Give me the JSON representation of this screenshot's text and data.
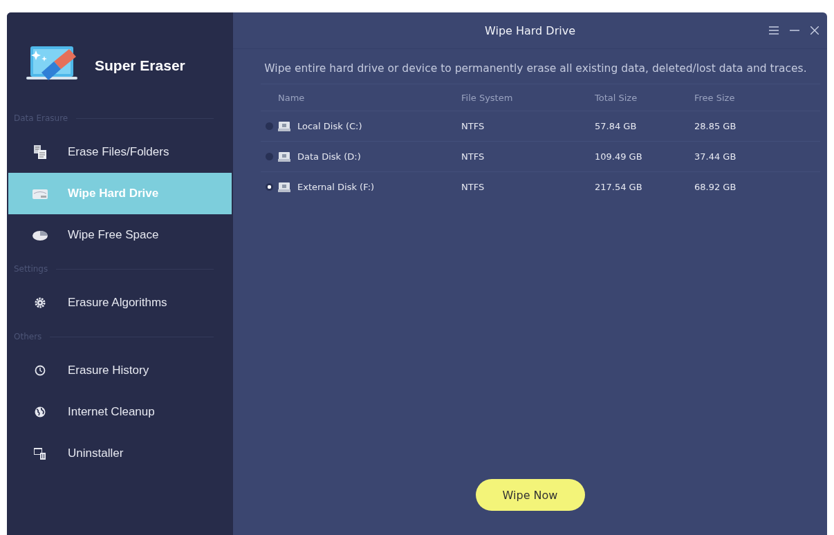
{
  "app": {
    "name": "Super Eraser"
  },
  "sidebar": {
    "sections": [
      {
        "header": "Data Erasure",
        "items": [
          {
            "label": "Erase Files/Folders",
            "selected": false
          },
          {
            "label": "Wipe Hard Drive",
            "selected": true
          },
          {
            "label": "Wipe Free Space",
            "selected": false
          }
        ]
      },
      {
        "header": "Settings",
        "items": [
          {
            "label": "Erasure Algorithms",
            "selected": false
          }
        ]
      },
      {
        "header": "Others",
        "items": [
          {
            "label": "Erasure History",
            "selected": false
          },
          {
            "label": "Internet Cleanup",
            "selected": false
          },
          {
            "label": "Uninstaller",
            "selected": false
          }
        ]
      }
    ]
  },
  "window": {
    "title": "Wipe Hard Drive"
  },
  "description": "Wipe entire hard drive or device to permanently erase all existing data, deleted/lost data and traces.",
  "table": {
    "columns": [
      "Name",
      "File System",
      "Total Size",
      "Free Size"
    ],
    "rows": [
      {
        "name": "Local Disk (C:)",
        "file_system": "NTFS",
        "total_size": "57.84 GB",
        "free_size": "28.85 GB",
        "selected": false
      },
      {
        "name": "Data Disk (D:)",
        "file_system": "NTFS",
        "total_size": "109.49 GB",
        "free_size": "37.44 GB",
        "selected": false
      },
      {
        "name": "External Disk (F:)",
        "file_system": "NTFS",
        "total_size": "217.54 GB",
        "free_size": "68.92 GB",
        "selected": true
      }
    ]
  },
  "action_button": "Wipe Now"
}
